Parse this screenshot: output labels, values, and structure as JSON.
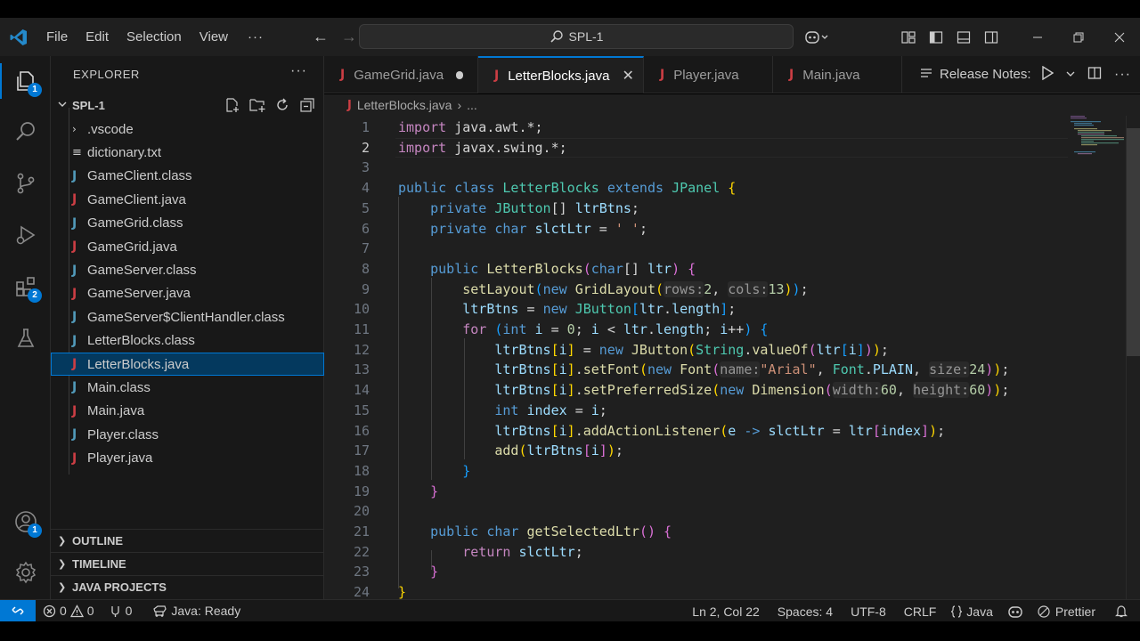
{
  "titlebar": {
    "menus": [
      "File",
      "Edit",
      "Selection",
      "View"
    ],
    "more": "···",
    "back_arrow": "←",
    "forward_arrow": "→",
    "search_text": "SPL-1"
  },
  "activity": {
    "explorer_badge": "1",
    "extensions_badge": "2",
    "accounts_badge": "1"
  },
  "sidebar": {
    "header": "EXPLORER",
    "header_more": "···",
    "root": "SPL-1",
    "files": [
      {
        "name": ".vscode",
        "type": "folder"
      },
      {
        "name": "dictionary.txt",
        "type": "text"
      },
      {
        "name": "GameClient.class",
        "type": "class"
      },
      {
        "name": "GameClient.java",
        "type": "java"
      },
      {
        "name": "GameGrid.class",
        "type": "class"
      },
      {
        "name": "GameGrid.java",
        "type": "java"
      },
      {
        "name": "GameServer.class",
        "type": "class"
      },
      {
        "name": "GameServer.java",
        "type": "java"
      },
      {
        "name": "GameServer$ClientHandler.class",
        "type": "class"
      },
      {
        "name": "LetterBlocks.class",
        "type": "class"
      },
      {
        "name": "LetterBlocks.java",
        "type": "java",
        "selected": true
      },
      {
        "name": "Main.class",
        "type": "class"
      },
      {
        "name": "Main.java",
        "type": "java"
      },
      {
        "name": "Player.class",
        "type": "class"
      },
      {
        "name": "Player.java",
        "type": "java"
      }
    ],
    "sections": [
      "OUTLINE",
      "TIMELINE",
      "JAVA PROJECTS"
    ]
  },
  "tabs": [
    {
      "label": "GameGrid.java",
      "state": "modified"
    },
    {
      "label": "LetterBlocks.java",
      "state": "active"
    },
    {
      "label": "Player.java",
      "state": "normal"
    },
    {
      "label": "Main.java",
      "state": "normal"
    }
  ],
  "release_notes_tab": "Release Notes:",
  "breadcrumb": {
    "file": "LetterBlocks.java",
    "sep": "›",
    "rest": "..."
  },
  "editor": {
    "active_line": 2,
    "line_numbers": [
      "1",
      "2",
      "3",
      "4",
      "5",
      "6",
      "7",
      "8",
      "9",
      "10",
      "11",
      "12",
      "13",
      "14",
      "15",
      "16",
      "17",
      "18",
      "19",
      "20",
      "21",
      "22",
      "23",
      "24"
    ]
  },
  "status": {
    "errors": "0",
    "warnings": "0",
    "ports": "0",
    "java_status": "Java: Ready",
    "cursor": "Ln 2, Col 22",
    "spaces": "Spaces: 4",
    "encoding": "UTF-8",
    "eol": "CRLF",
    "language": "Java",
    "formatter": "Prettier"
  },
  "colors": {
    "accent": "#0078d4",
    "java_icon": "#cc3e44",
    "class_icon": "#519aba"
  }
}
